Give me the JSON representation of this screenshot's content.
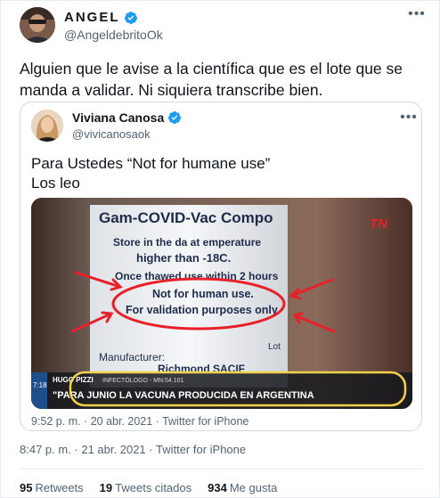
{
  "tweet": {
    "author_name": "ANGEL",
    "author_handle": "@AngeldebritoOk",
    "text": "Alguien que le avise a la científica que es el lote que se manda a validar. Ni siquiera transcribe bien.",
    "timestamp": "8:47 p. m. · 21 abr. 2021 · Twitter for iPhone",
    "more_icon": "more-horizontal-icon",
    "stats": [
      {
        "count": "95",
        "label": "Retweets"
      },
      {
        "count": "19",
        "label": "Tweets citados"
      },
      {
        "count": "934",
        "label": "Me gusta"
      }
    ]
  },
  "quoted": {
    "author_name": "Viviana Canosa",
    "author_handle": "@vivicanosaok",
    "text_line1": "Para Ustedes “Not for humane use”",
    "text_line2": "Los leo",
    "timestamp": "9:52 p. m. · 20 abr. 2021 · Twitter for iPhone",
    "image": {
      "label_title": "Gam-COVID-Vac Compo",
      "line1": "Store in the da  at  emperature",
      "line2": "higher than -18C.",
      "line3": "Once thawed use within 2 hours",
      "line4": "Not for human use.",
      "line5": "For validation purposes only",
      "line6": "Manufacturer:",
      "line7": "Richmond SACIF",
      "lot": "Lot",
      "tv_logo": "TN",
      "tv_time": "7:18",
      "tv_name": "HUGO PIZZI",
      "tv_role": "INFECTÓLOGO - MN:54.101",
      "headline": "\"PARA JUNIO LA VACUNA PRODUCIDA EN ARGENTINA"
    }
  },
  "colors": {
    "verified": "#1d9bf0",
    "text": "#0f1419",
    "secondary": "#536471",
    "border": "#cfd9de",
    "annotation_red": "#e8202a",
    "annotation_yellow": "#f2d24a"
  }
}
